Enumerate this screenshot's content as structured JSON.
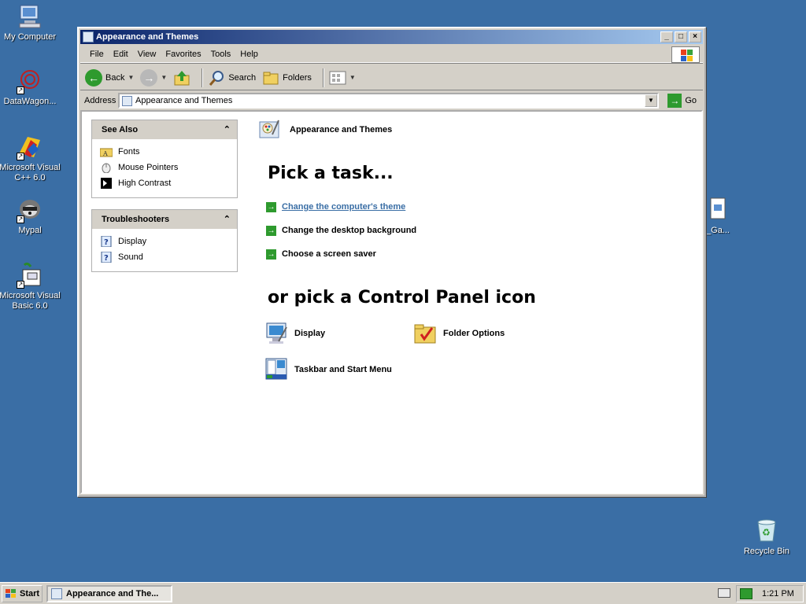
{
  "desktop": {
    "icons": [
      {
        "label": "My Computer",
        "icon": "my-computer-icon"
      },
      {
        "label": "DataWagon...",
        "icon": "datawagon-icon"
      },
      {
        "label": "Microsoft Visual C++ 6.0",
        "icon": "visual-cpp-icon"
      },
      {
        "label": "Mypal",
        "icon": "mypal-icon"
      },
      {
        "label": "Microsoft Visual Basic 6.0",
        "icon": "visual-basic-icon"
      },
      {
        "label": "_Ga...",
        "icon": "file-icon"
      },
      {
        "label": "Recycle Bin",
        "icon": "recycle-bin-icon"
      }
    ]
  },
  "window": {
    "title": "Appearance and Themes",
    "controls": {
      "minimize": "_",
      "maximize": "□",
      "close": "×"
    }
  },
  "menu": [
    "File",
    "Edit",
    "View",
    "Favorites",
    "Tools",
    "Help"
  ],
  "toolbar": {
    "back": "Back",
    "search": "Search",
    "folders": "Folders"
  },
  "address": {
    "label": "Address",
    "value": "Appearance and Themes",
    "go": "Go"
  },
  "see_also": {
    "title": "See Also",
    "items": [
      "Fonts",
      "Mouse Pointers",
      "High Contrast"
    ]
  },
  "troubleshooters": {
    "title": "Troubleshooters",
    "items": [
      "Display",
      "Sound"
    ]
  },
  "main": {
    "header": "Appearance and Themes",
    "pick_task": "Pick a task...",
    "tasks": [
      "Change the computer's theme",
      "Change the desktop background",
      "Choose a screen saver"
    ],
    "pick_icon": "or pick a Control Panel icon",
    "icons": [
      "Display",
      "Folder Options",
      "Taskbar and Start Menu"
    ]
  },
  "taskbar": {
    "start": "Start",
    "task": "Appearance and The...",
    "clock": "1:21 PM"
  },
  "colors": {
    "desktop": "#3a6ea5",
    "titlebar_start": "#0a246a",
    "titlebar_end": "#a6caf0",
    "link": "#3a6ea5",
    "task_arrow": "#2e9a2e"
  }
}
